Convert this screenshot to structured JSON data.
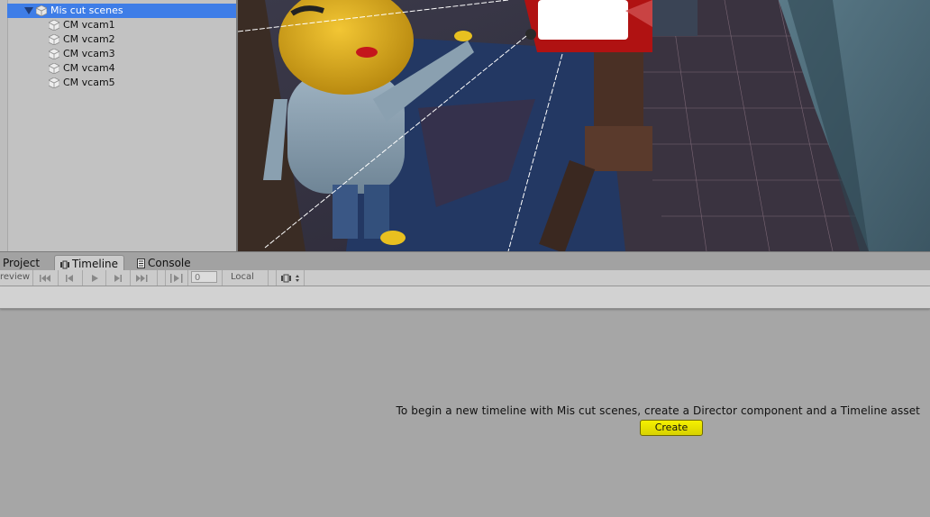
{
  "hierarchy": {
    "items": [
      {
        "label": "Mis cut scenes",
        "selected": true,
        "expanded": true,
        "icon": "gameobject-cube-icon"
      },
      {
        "label": "CM vcam1",
        "icon": "gameobject-cube-icon"
      },
      {
        "label": "CM vcam2",
        "icon": "gameobject-cube-icon"
      },
      {
        "label": "CM vcam3",
        "icon": "gameobject-cube-icon"
      },
      {
        "label": "CM vcam4",
        "icon": "gameobject-cube-icon"
      },
      {
        "label": "CM vcam5",
        "icon": "gameobject-cube-icon"
      }
    ]
  },
  "tabs": [
    {
      "label": "Project",
      "icon": "folder-icon"
    },
    {
      "label": "Timeline",
      "icon": "timeline-icon",
      "active": true
    },
    {
      "label": "Console",
      "icon": "console-icon"
    }
  ],
  "toolbar": {
    "preview_label": "review",
    "frame_value": "0",
    "time_mode_label": "Local",
    "icons": [
      "jump-to-start-icon",
      "previous-frame-icon",
      "play-icon",
      "next-frame-icon",
      "jump-to-end-icon",
      "play-range-icon",
      "timeline-dropdown-icon"
    ]
  },
  "empty_state": {
    "message": "To begin a new timeline with Mis cut scenes, create a Director component and a Timeline asset",
    "create_label": "Create"
  },
  "colors": {
    "selection": "#3e7de7",
    "create_button": "#e8e300",
    "panel_bg": "#a6a6a6"
  }
}
